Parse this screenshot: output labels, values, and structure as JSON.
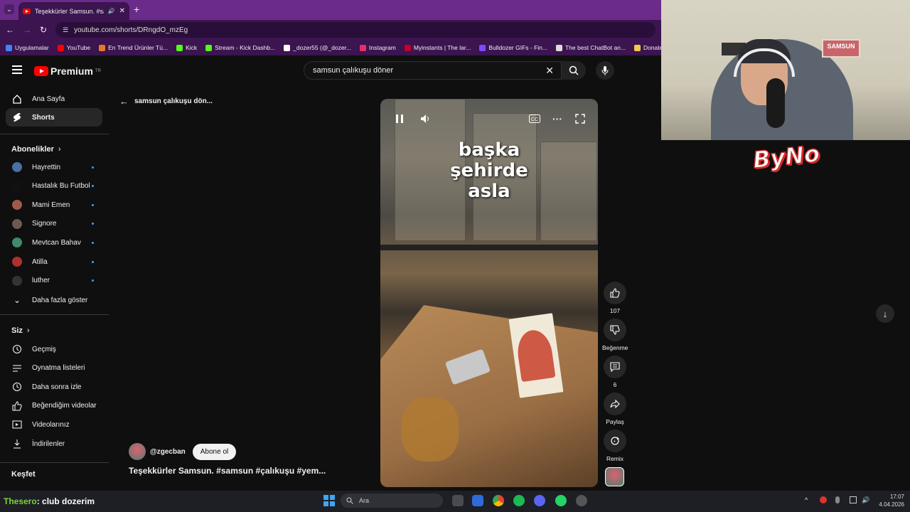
{
  "browser": {
    "tab_title": "Teşekkürler Samsun. #samsu",
    "url": "youtube.com/shorts/DRngdO_mzEg",
    "bookmarks": [
      {
        "label": "Uygulamalar",
        "color": "#4285f4"
      },
      {
        "label": "YouTube",
        "color": "#ff0000"
      },
      {
        "label": "En Trend Ürünler Tü...",
        "color": "#e07b2a"
      },
      {
        "label": "Kick",
        "color": "#53fc18"
      },
      {
        "label": "Stream - Kick Dashb...",
        "color": "#53fc18"
      },
      {
        "label": "_dozer55 (@_dozer...",
        "color": "#ffffff"
      },
      {
        "label": "Instagram",
        "color": "#e1306c"
      },
      {
        "label": "Myinstants | The lar...",
        "color": "#c4002b"
      },
      {
        "label": "Bulldozer GIFs - Fin...",
        "color": "#7a4cff"
      },
      {
        "label": "The best ChatBot an...",
        "color": "#dddddd"
      },
      {
        "label": "Donate ByNoGam",
        "color": "#f2c94c"
      }
    ]
  },
  "header": {
    "logo_text": "Premium",
    "logo_badge": "TR",
    "search_value": "samsun çalıkuşu döner"
  },
  "sidebar": {
    "main": [
      {
        "label": "Ana Sayfa",
        "icon": "home-icon"
      },
      {
        "label": "Shorts",
        "icon": "shorts-icon",
        "active": true
      }
    ],
    "subs_title": "Abonelikler",
    "subscriptions": [
      {
        "label": "Hayrettin",
        "color": "#4a6fa5"
      },
      {
        "label": "Hastalık Bu Futbol",
        "color": "#111111"
      },
      {
        "label": "Mami Emen",
        "color": "#a05a4a"
      },
      {
        "label": "Signore",
        "color": "#6a5a50"
      },
      {
        "label": "Mevtcan Bahav",
        "color": "#3f8a6a"
      },
      {
        "label": "Atilla",
        "color": "#b03030"
      },
      {
        "label": "luther",
        "color": "#333333"
      }
    ],
    "show_more": "Daha fazla göster",
    "you_title": "Siz",
    "you_items": [
      {
        "label": "Geçmiş",
        "icon": "history-icon"
      },
      {
        "label": "Oynatma listeleri",
        "icon": "playlist-icon"
      },
      {
        "label": "Daha sonra izle",
        "icon": "clock-icon"
      },
      {
        "label": "Beğendiğim videolar",
        "icon": "thumbs-up-icon"
      },
      {
        "label": "Videolarınız",
        "icon": "your-videos-icon"
      },
      {
        "label": "İndirilenler",
        "icon": "download-icon"
      }
    ],
    "explore_title": "Keşfet"
  },
  "shorts": {
    "back_label": "samsun çalıkuşu dön...",
    "overlay_lines": [
      "başka",
      "şehirde",
      "asla"
    ],
    "actions": {
      "likes": "107",
      "dislike_label": "Beğenme",
      "comments": "6",
      "share_label": "Paylaş",
      "remix_label": "Remix"
    },
    "channel": "@zgecban",
    "subscribe_label": "Abone ol",
    "title": "Teşekkürler Samsun. #samsun #çalıkuşu #yem..."
  },
  "overlay": {
    "cam_sign": "SAMSUN",
    "brand": "ByNo",
    "chat_user": "Thesero",
    "chat_message": ": club dozerim"
  },
  "taskbar": {
    "search_placeholder": "Ara",
    "time": "17:07",
    "date": "4.04.2026"
  }
}
